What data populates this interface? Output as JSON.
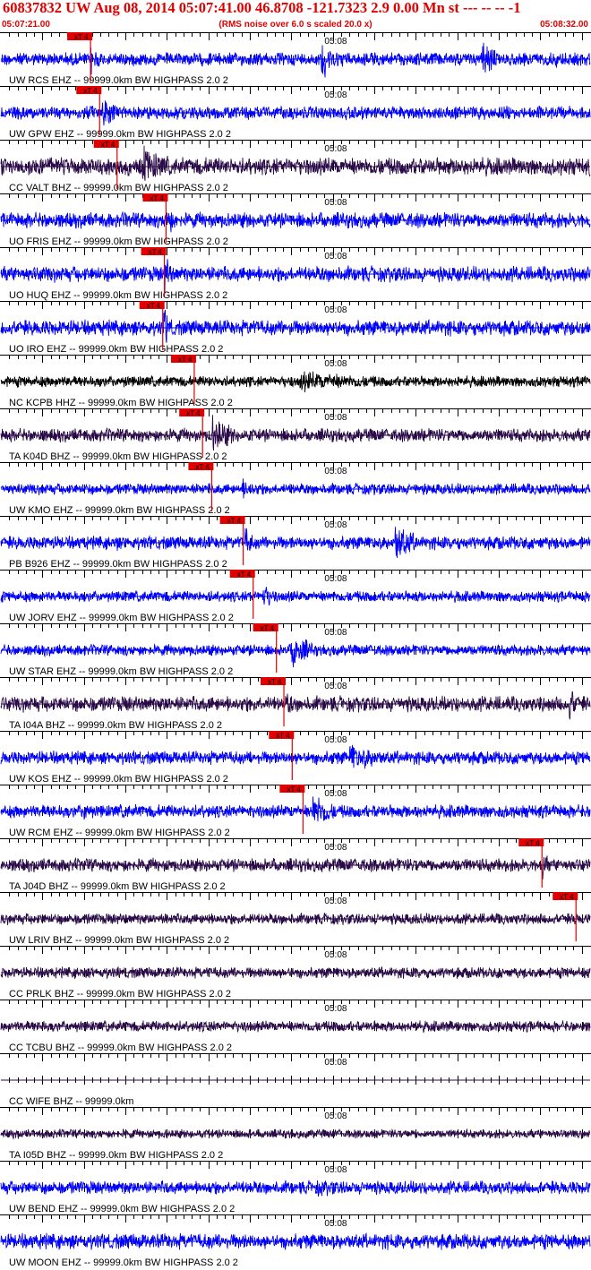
{
  "header": {
    "title": "60837832 UW Aug 08, 2014 05:07:41.00   46.8708 -121.7323  2.9 0.00 Mn st --- -- --  -1",
    "start_time": "05:07:21.00",
    "noise_note": "(RMS noise over 6.0 s scaled 20.0 x)",
    "end_time": "05:08:32.00"
  },
  "chart_data": {
    "type": "line",
    "time_range_s": [
      0,
      71
    ],
    "minute_tick_label": "05:08",
    "minute_tick_s": 39,
    "colors": {
      "blue": "#0000ff",
      "dark": "#2b0a4a",
      "black": "#000000",
      "pick": "#e00000",
      "grid": "#000000"
    },
    "traces": [
      {
        "label": "UW RCS EHZ -- 99999.0km BW  HIGHPASS  2.0  2",
        "color": "blue",
        "pick_s": 10.8,
        "pick_label": "xT 4",
        "amp": 0.3,
        "events": [
          [
            10.8,
            0.9,
            1.5
          ],
          [
            38.6,
            1.0,
            3.5
          ],
          [
            44.5,
            0.6,
            0.7
          ],
          [
            58.0,
            1.0,
            2.5
          ],
          [
            66.8,
            0.6,
            0.7
          ]
        ]
      },
      {
        "label": "UW GPW EHZ -- 99999.0km BW  HIGHPASS  2.0  2",
        "color": "blue",
        "pick_s": 11.9,
        "pick_label": "xT 4",
        "amp": 0.3,
        "events": [
          [
            12.2,
            1.0,
            2.5
          ]
        ]
      },
      {
        "label": "CC VALT BHZ -- 99999.0km BW  HIGHPASS  2.0  2",
        "color": "dark",
        "pick_s": 14.0,
        "pick_label": "xT 4",
        "amp": 0.4,
        "events": [
          [
            17.0,
            1.0,
            6.0
          ]
        ]
      },
      {
        "label": "UO FRIS EHZ -- 99999.0km BW  HIGHPASS  2.0  2",
        "color": "blue",
        "pick_s": 19.9,
        "pick_label": "xT 4",
        "amp": 0.35,
        "events": [
          [
            19.9,
            1.0,
            1.5
          ]
        ]
      },
      {
        "label": "UO HUQ EHZ -- 99999.0km BW  HIGHPASS  2.0  2",
        "color": "blue",
        "pick_s": 19.7,
        "pick_label": "xT 4",
        "amp": 0.35,
        "events": [
          [
            19.7,
            1.0,
            1.5
          ]
        ]
      },
      {
        "label": "UO IRO EHZ -- 99999.0km BW  HIGHPASS  2.0  2",
        "color": "blue",
        "pick_s": 19.5,
        "pick_label": "xT 4",
        "amp": 0.35,
        "events": [
          [
            19.6,
            1.0,
            1.5
          ],
          [
            38.2,
            0.4,
            0.5
          ]
        ]
      },
      {
        "label": "NC KCPB HHZ -- 99999.0km BW  HIGHPASS  2.0  2",
        "color": "black",
        "pick_s": 23.3,
        "pick_label": "xT 4",
        "amp": 0.25,
        "events": [
          [
            36.0,
            0.5,
            22.0
          ]
        ]
      },
      {
        "label": "TA K04D BHZ -- 99999.0km BW  HIGHPASS  2.0  2",
        "color": "dark",
        "pick_s": 24.3,
        "pick_label": "xT 4",
        "amp": 0.3,
        "events": [
          [
            25.5,
            1.0,
            4.0
          ]
        ]
      },
      {
        "label": "UW KMO EHZ -- 99999.0km BW  HIGHPASS  2.0  2",
        "color": "blue",
        "pick_s": 25.4,
        "pick_label": "xT 4",
        "amp": 0.25,
        "events": [
          [
            29.0,
            0.5,
            6.0
          ]
        ]
      },
      {
        "label": "PB B926 EHZ -- 99999.0km BW  HIGHPASS  2.0  2",
        "color": "blue",
        "pick_s": 29.2,
        "pick_label": "xT 4",
        "amp": 0.3,
        "events": [
          [
            29.3,
            0.9,
            1.5
          ],
          [
            47.5,
            1.0,
            4.0
          ],
          [
            13.8,
            0.5,
            1.0
          ]
        ]
      },
      {
        "label": "UW JORV EHZ -- 99999.0km BW  HIGHPASS  2.0  2",
        "color": "blue",
        "pick_s": 30.4,
        "pick_label": "xT 4",
        "amp": 0.25,
        "events": [
          [
            31.5,
            0.7,
            2.5
          ],
          [
            66.5,
            0.3,
            1.0
          ]
        ]
      },
      {
        "label": "UW STAR EHZ -- 99999.0km BW  HIGHPASS  2.0  2",
        "color": "blue",
        "pick_s": 33.2,
        "pick_label": "xT 4",
        "amp": 0.25,
        "events": [
          [
            35.0,
            1.0,
            3.5
          ]
        ]
      },
      {
        "label": "TA I04A BHZ -- 99999.0km BW  HIGHPASS  2.0  2",
        "color": "dark",
        "pick_s": 34.1,
        "pick_label": "xT 4",
        "amp": 0.35,
        "events": [
          [
            34.5,
            0.7,
            1.5
          ],
          [
            68.5,
            0.9,
            2.0
          ]
        ]
      },
      {
        "label": "UW KOS EHZ -- 99999.0km BW  HIGHPASS  2.0  2",
        "color": "blue",
        "pick_s": 35.1,
        "pick_label": "xT 4",
        "amp": 0.3,
        "events": [
          [
            42.0,
            0.7,
            8.0
          ]
        ]
      },
      {
        "label": "UW RCM EHZ -- 99999.0km BW  HIGHPASS  2.0  2",
        "color": "blue",
        "pick_s": 36.4,
        "pick_label": "xT 4",
        "amp": 0.3,
        "events": [
          [
            37.5,
            1.0,
            4.0
          ],
          [
            10.0,
            0.6,
            2.0
          ]
        ]
      },
      {
        "label": "TA J04D BHZ -- 99999.0km BW  HIGHPASS  2.0  2",
        "color": "dark",
        "pick_s": 65.2,
        "pick_label": "xT 4",
        "amp": 0.3,
        "events": [
          [
            65.2,
            0.8,
            1.2
          ]
        ]
      },
      {
        "label": "UW LRIV BHZ -- 99999.0km BW  HIGHPASS  2.0  2",
        "color": "dark",
        "pick_s": 69.3,
        "pick_label": "xT 4",
        "amp": 0.25,
        "events": []
      },
      {
        "label": "CC PRLK BHZ -- 99999.0km BW  HIGHPASS  2.0  2",
        "color": "dark",
        "pick_s": null,
        "pick_label": "",
        "amp": 0.25,
        "events": []
      },
      {
        "label": "CC TCBU BHZ -- 99999.0km BW  HIGHPASS  2.0  2",
        "color": "dark",
        "pick_s": null,
        "pick_label": "",
        "amp": 0.25,
        "events": []
      },
      {
        "label": "CC WIFE BHZ -- 99999.0km",
        "color": "dark",
        "pick_s": null,
        "pick_label": "",
        "amp": 0.0,
        "events": []
      },
      {
        "label": "TA I05D BHZ -- 99999.0km BW  HIGHPASS  2.0  2",
        "color": "dark",
        "pick_s": null,
        "pick_label": "",
        "amp": 0.2,
        "events": []
      },
      {
        "label": "UW BEND EHZ -- 99999.0km BW  HIGHPASS  2.0  2",
        "color": "blue",
        "pick_s": null,
        "pick_label": "",
        "amp": 0.3,
        "events": [
          [
            38.0,
            0.4,
            15.0
          ]
        ]
      },
      {
        "label": "UW MOON EHZ -- 99999.0km BW  HIGHPASS  2.0  2",
        "color": "blue",
        "pick_s": null,
        "pick_label": "",
        "amp": 0.35,
        "events": []
      }
    ]
  }
}
